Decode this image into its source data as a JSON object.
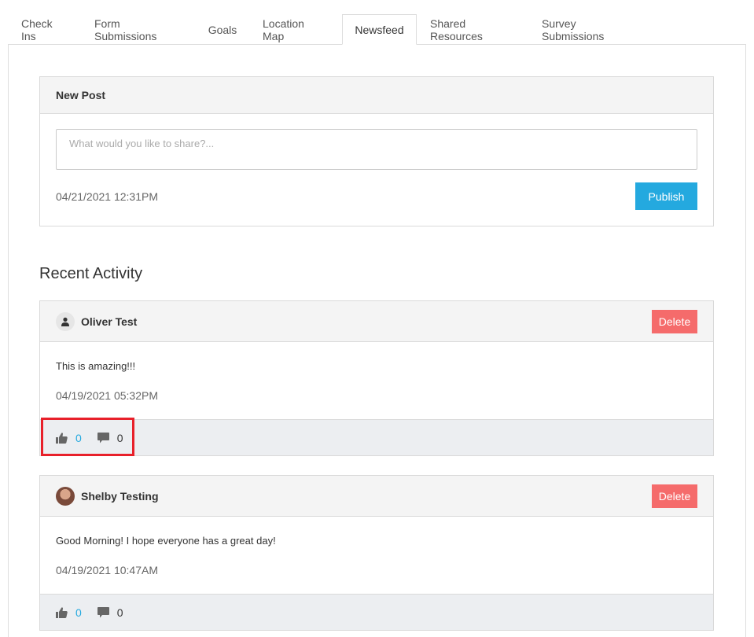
{
  "tabs": [
    {
      "label": "Check Ins"
    },
    {
      "label": "Form Submissions"
    },
    {
      "label": "Goals"
    },
    {
      "label": "Location Map"
    },
    {
      "label": "Newsfeed",
      "active": true
    },
    {
      "label": "Shared Resources"
    },
    {
      "label": "Survey Submissions"
    }
  ],
  "new_post": {
    "title": "New Post",
    "placeholder": "What would you like to share?...",
    "date": "04/21/2021 12:31PM",
    "publish_label": "Publish"
  },
  "recent_activity": {
    "title": "Recent Activity",
    "posts": [
      {
        "author": "Oliver Test",
        "avatar": "user-icon",
        "delete_label": "Delete",
        "text": "This is amazing!!!",
        "date": "04/19/2021 05:32PM",
        "likes": "0",
        "comments": "0"
      },
      {
        "author": "Shelby Testing",
        "avatar": "photo",
        "delete_label": "Delete",
        "text": "Good Morning! I hope everyone has a great day!",
        "date": "04/19/2021 10:47AM",
        "likes": "0",
        "comments": "0"
      }
    ]
  },
  "colors": {
    "accent": "#24a9df",
    "delete": "#f56b6b",
    "highlight": "#e8202a",
    "footer_bg": "#eceef1"
  }
}
